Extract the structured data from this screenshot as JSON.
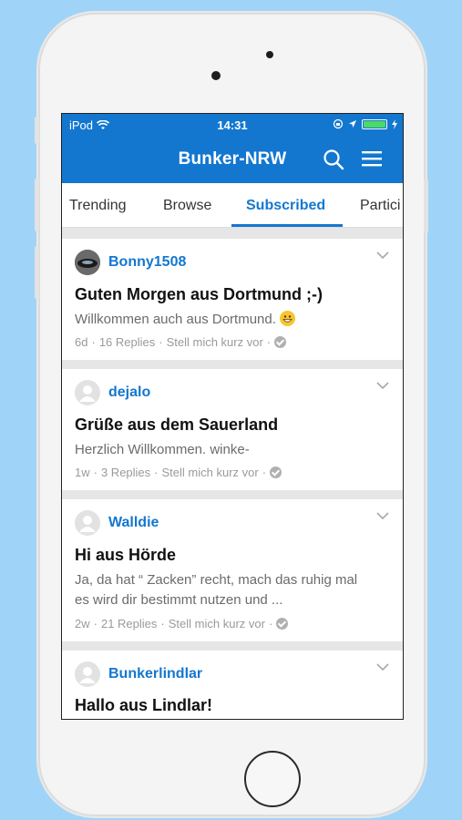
{
  "status": {
    "carrier": "iPod",
    "time": "14:31"
  },
  "header": {
    "title": "Bunker-NRW",
    "search_icon": "search-icon",
    "menu_icon": "hamburger-menu-icon"
  },
  "tabs": [
    {
      "label": "Trending"
    },
    {
      "label": "Browse"
    },
    {
      "label": "Subscribed"
    },
    {
      "label": "Partici"
    }
  ],
  "posts": [
    {
      "user": "Bonny1508",
      "title": "Guten Morgen aus Dortmund ;-)",
      "excerpt": "Willkommen auch aus Dortmund.",
      "age": "6d",
      "replies": "16 Replies",
      "category": "Stell mich kurz vor"
    },
    {
      "user": "dejalo",
      "title": "Grüße aus dem Sauerland",
      "excerpt": "Herzlich Willkommen. winke-",
      "age": "1w",
      "replies": "3 Replies",
      "category": "Stell mich kurz vor"
    },
    {
      "user": "Walldie",
      "title": "Hi aus Hörde",
      "excerpt": "Ja, da hat “ Zacken” recht, mach das ruhig mal es wird dir bestimmt nutzen und ...",
      "age": "2w",
      "replies": "21 Replies",
      "category": "Stell mich kurz vor"
    },
    {
      "user": "Bunkerlindlar",
      "title": "Hallo aus Lindlar!"
    }
  ],
  "colors": {
    "accent": "#1377d0",
    "background": "#9fd4f8"
  }
}
